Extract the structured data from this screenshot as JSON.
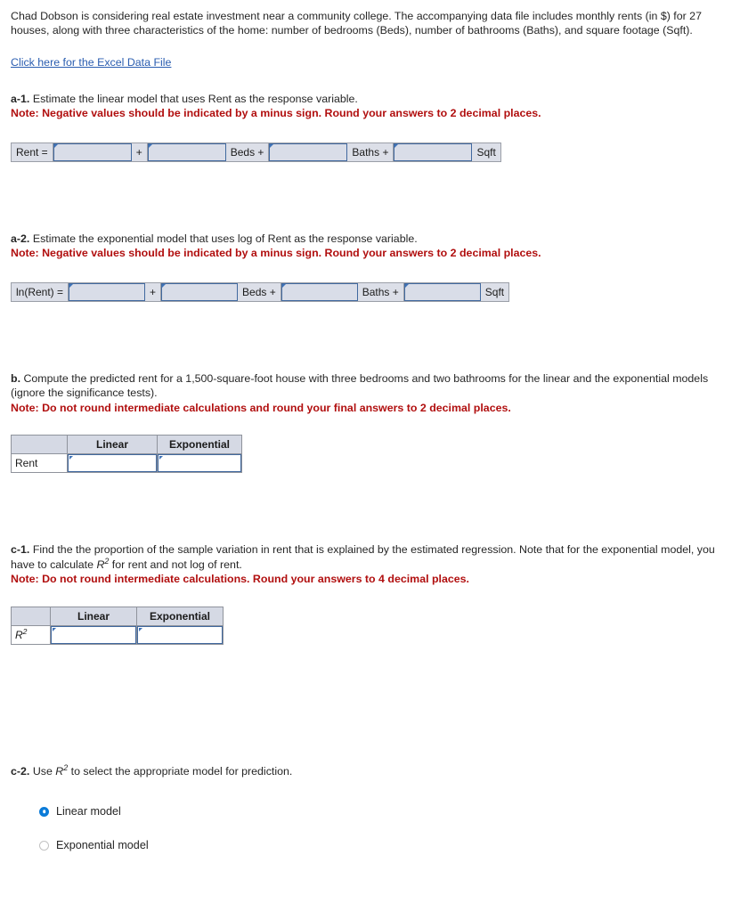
{
  "intro": {
    "paragraph": "Chad Dobson is considering real estate investment near a community college. The accompanying data file includes monthly rents (in $) for 27 houses, along with three characteristics of the home: number of bedrooms (Beds), number of bathrooms (Baths), and square footage (Sqft).",
    "data_file_link": "Click here for the Excel Data File"
  },
  "colors": {
    "note_red": "#b10f0f",
    "link_blue": "#2a5db0",
    "input_border_blue": "#41699f",
    "input_fill": "#d9dde8",
    "strip_background": "#dcdfe8",
    "header_fill": "#d5d9e4",
    "radio_selected": "#0b7bd8"
  },
  "a1": {
    "label": "a-1.",
    "prompt": "Estimate the linear model that uses Rent as the response variable.",
    "note": "Note: Negative values should be indicated by a minus sign. Round your answers to 2 decimal places.",
    "equation": {
      "lead_label": "Rent =",
      "plus": "+",
      "term_beds": "Beds +",
      "term_baths": "Baths +",
      "term_sqft": "Sqft",
      "intercept_value": "",
      "beds_value": "",
      "baths_value": "",
      "sqft_value": ""
    }
  },
  "a2": {
    "label": "a-2.",
    "prompt": "Estimate the exponential model that uses log of Rent as the response variable.",
    "note": "Note: Negative values should be indicated by a minus sign. Round your answers to 2 decimal places.",
    "equation": {
      "lead_label": "ln(Rent) =",
      "plus": "+",
      "term_beds": "Beds +",
      "term_baths": "Baths +",
      "term_sqft": "Sqft",
      "intercept_value": "",
      "beds_value": "",
      "baths_value": "",
      "sqft_value": ""
    }
  },
  "b": {
    "label": "b.",
    "prompt": "Compute the predicted rent for a 1,500-square-foot house with three bedrooms and two bathrooms for the linear and the exponential models (ignore the significance tests).",
    "note": "Note: Do not round intermediate calculations and round your final answers to 2 decimal places.",
    "table": {
      "corner": "",
      "headers": [
        "Linear",
        "Exponential"
      ],
      "rows": [
        {
          "label": "Rent",
          "linear_value": "",
          "exponential_value": ""
        }
      ]
    }
  },
  "c1": {
    "label": "c-1.",
    "prompt_part1": "Find the the proportion of the sample variation in rent that is explained by the estimated regression. Note that for the exponential model, you have to calculate ",
    "r2_inline": "R2",
    "prompt_part2": " for rent and not log of rent.",
    "note": "Note: Do not round intermediate calculations. Round your answers to 4 decimal places.",
    "table": {
      "corner": "",
      "headers": [
        "Linear",
        "Exponential"
      ],
      "rows": [
        {
          "label": "R2",
          "linear_value": "",
          "exponential_value": ""
        }
      ]
    }
  },
  "c2": {
    "label": "c-2.",
    "prompt_part1": "Use ",
    "r2_inline": "R2",
    "prompt_part2": " to select the appropriate model for prediction.",
    "options": [
      {
        "label": "Linear model",
        "selected": true
      },
      {
        "label": "Exponential model",
        "selected": false
      }
    ]
  }
}
